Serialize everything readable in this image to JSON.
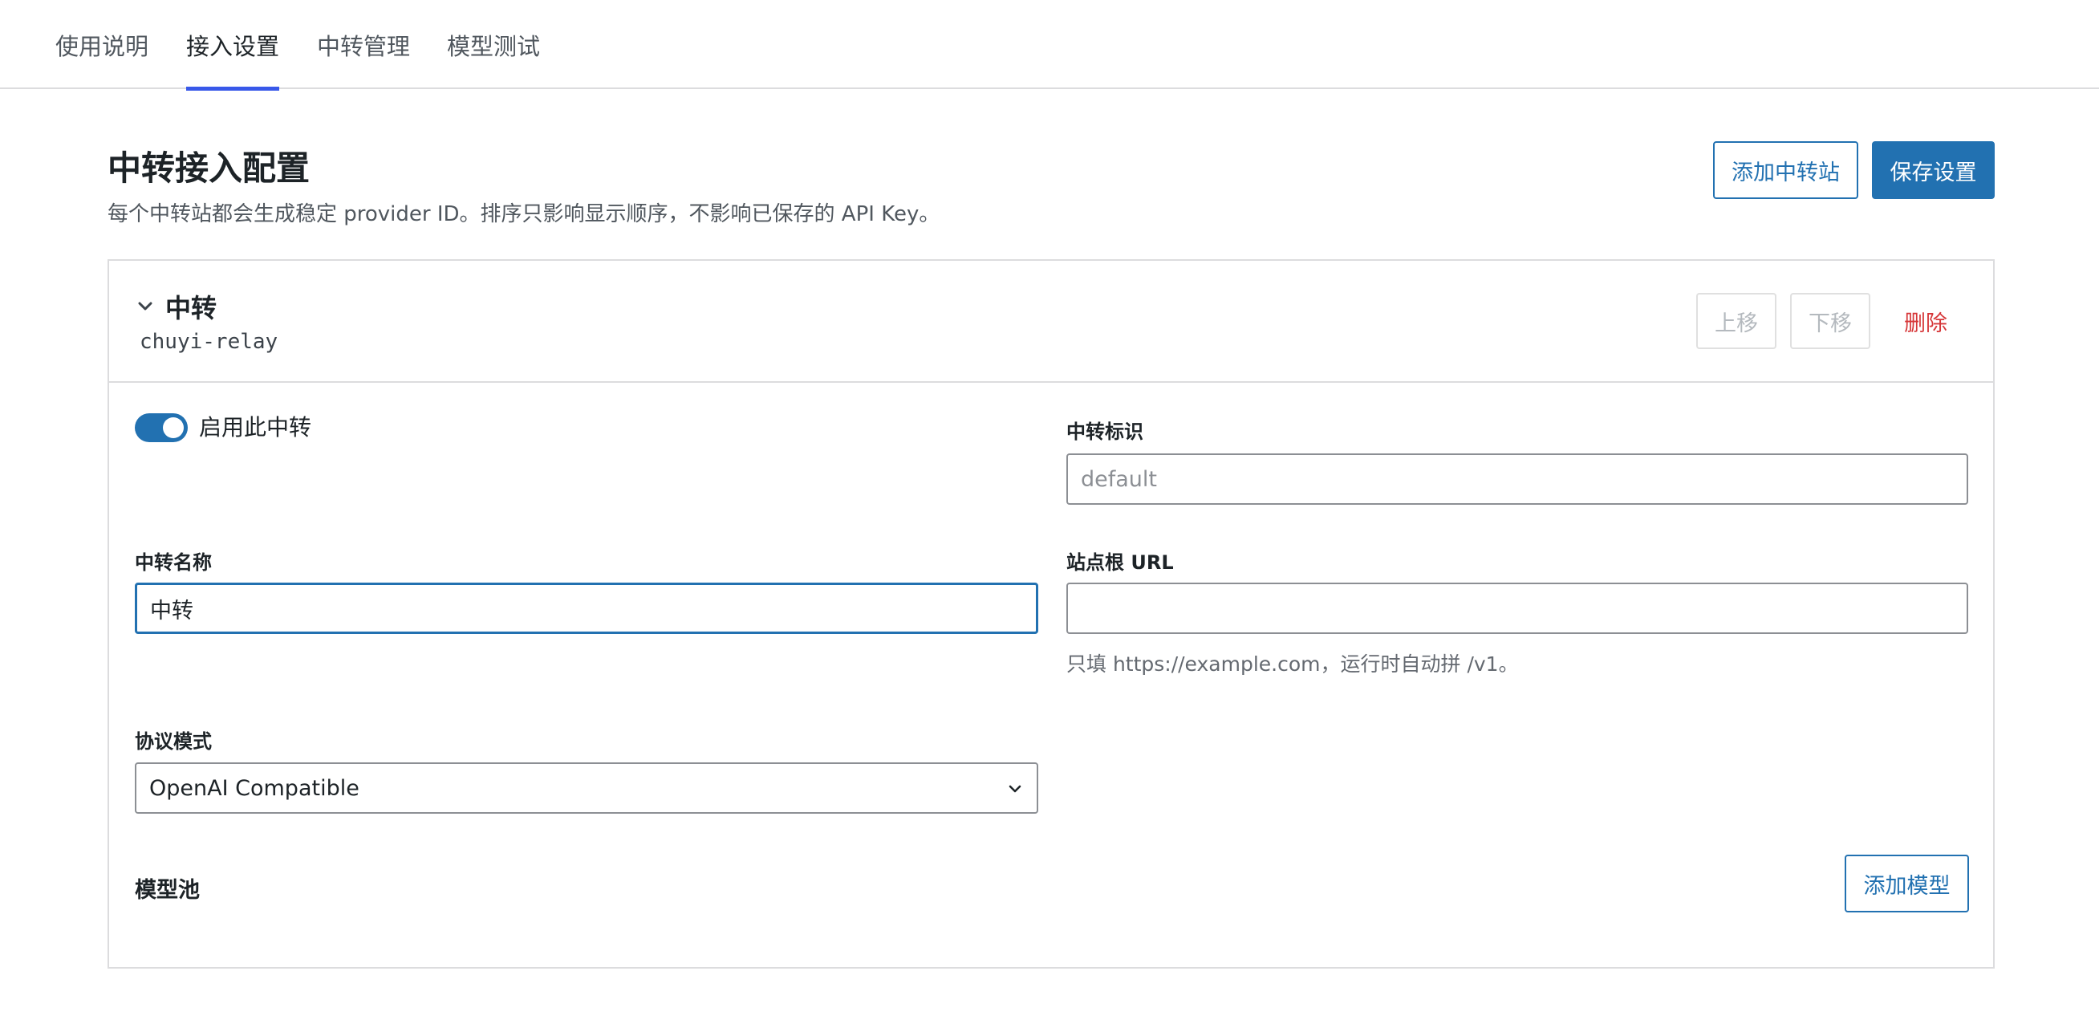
{
  "tabs": [
    {
      "label": "使用说明",
      "active": false
    },
    {
      "label": "接入设置",
      "active": true
    },
    {
      "label": "中转管理",
      "active": false
    },
    {
      "label": "模型测试",
      "active": false
    }
  ],
  "header": {
    "title": "中转接入配置",
    "description": "每个中转站都会生成稳定 provider ID。排序只影响显示顺序，不影响已保存的 API Key。",
    "add_relay_button": "添加中转站",
    "save_button": "保存设置"
  },
  "relay": {
    "title": "中转",
    "provider_id": "chuyi-relay",
    "move_up_button": "上移",
    "move_down_button": "下移",
    "delete_button": "删除",
    "enable_label": "启用此中转",
    "enabled": true,
    "slug_label": "中转标识",
    "slug_placeholder": "default",
    "name_label": "中转名称",
    "name_value": "中转",
    "url_label": "站点根 URL",
    "url_value": "",
    "url_help": "只填 https://example.com，运行时自动拼 /v1。",
    "protocol_label": "协议模式",
    "protocol_value": "OpenAI Compatible",
    "model_pool_label": "模型池",
    "add_model_button": "添加模型"
  },
  "colors": {
    "accent": "#2271b1",
    "tab_underline": "#3858e9",
    "danger": "#d63638"
  }
}
